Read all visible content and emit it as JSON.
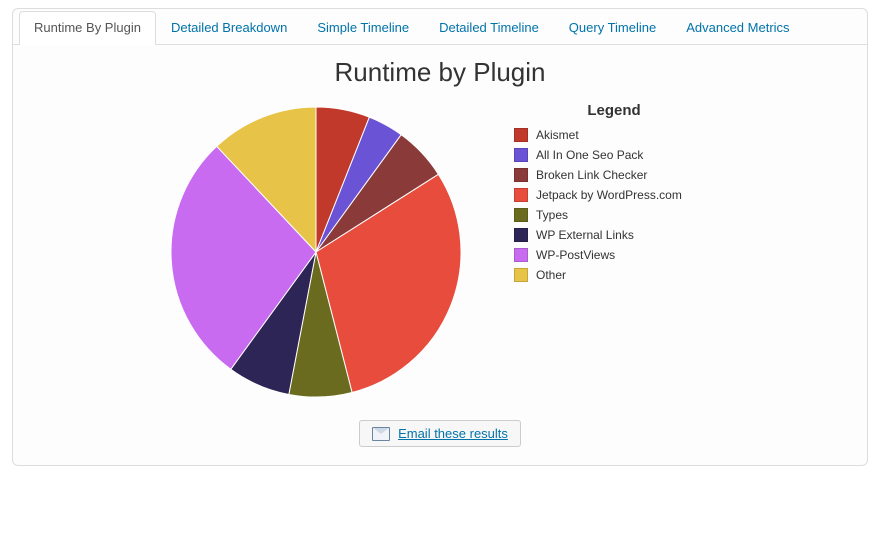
{
  "tabs": {
    "items": [
      {
        "label": "Runtime By Plugin",
        "active": true
      },
      {
        "label": "Detailed Breakdown",
        "active": false
      },
      {
        "label": "Simple Timeline",
        "active": false
      },
      {
        "label": "Detailed Timeline",
        "active": false
      },
      {
        "label": "Query Timeline",
        "active": false
      },
      {
        "label": "Advanced Metrics",
        "active": false
      }
    ]
  },
  "title": "Runtime by Plugin",
  "legend_title": "Legend",
  "email_label": "Email these results",
  "chart_data": {
    "type": "pie",
    "title": "Runtime by Plugin",
    "series": [
      {
        "name": "Akismet",
        "value": 6,
        "color": "#c0392b"
      },
      {
        "name": "All In One Seo Pack",
        "value": 4,
        "color": "#6b53d6"
      },
      {
        "name": "Broken Link Checker",
        "value": 6,
        "color": "#8b3a3a"
      },
      {
        "name": "Jetpack by WordPress.com",
        "value": 30,
        "color": "#e74c3c"
      },
      {
        "name": "Types",
        "value": 7,
        "color": "#6b6b1f"
      },
      {
        "name": "WP External Links",
        "value": 7,
        "color": "#2d2555"
      },
      {
        "name": "WP-PostViews",
        "value": 28,
        "color": "#c86bf0"
      },
      {
        "name": "Other",
        "value": 12,
        "color": "#e7c447"
      }
    ]
  }
}
